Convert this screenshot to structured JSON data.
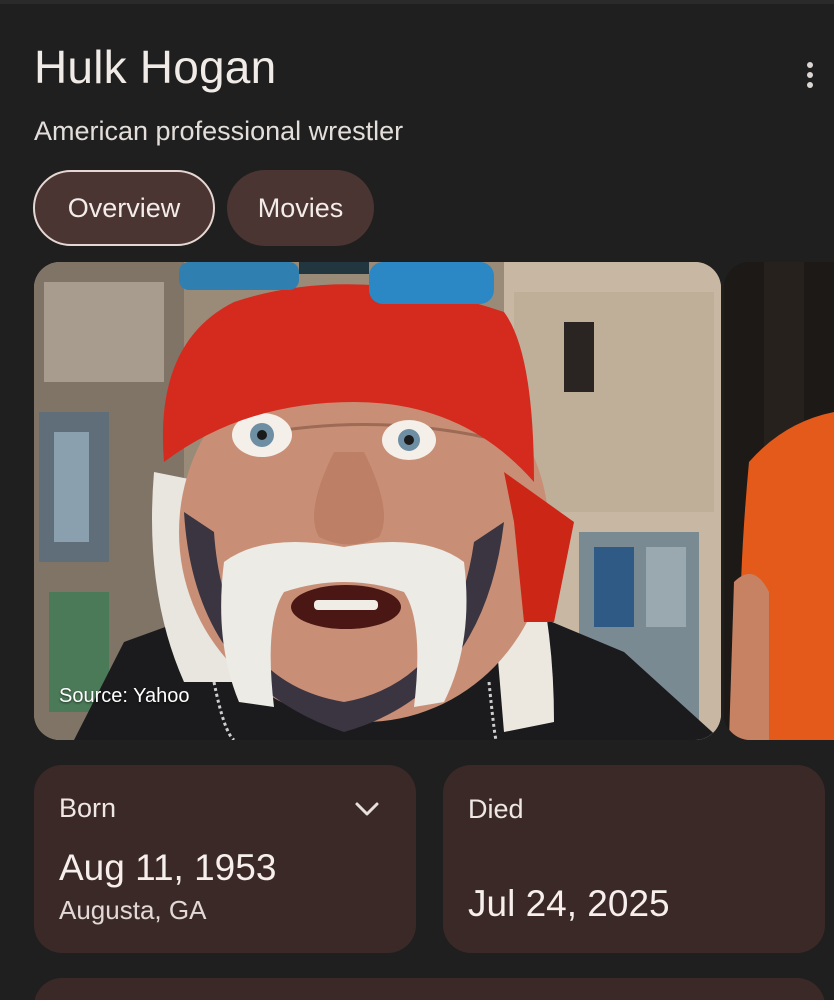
{
  "header": {
    "title": "Hulk Hogan",
    "subtitle": "American professional wrestler",
    "more_icon": "more-vert-icon"
  },
  "tabs": [
    {
      "label": "Overview",
      "active": true
    },
    {
      "label": "Movies",
      "active": false
    }
  ],
  "hero": {
    "source": "Source: Yahoo"
  },
  "facts": {
    "born": {
      "label": "Born",
      "date": "Aug 11, 1953",
      "place": "Augusta, GA",
      "icon": "chevron-down-icon"
    },
    "died": {
      "label": "Died",
      "date": "Jul 24, 2025"
    }
  },
  "colors": {
    "background": "#1f1f1f",
    "chip": "#4a3532",
    "card": "#3b2927",
    "bandana": "#d52b1e"
  }
}
